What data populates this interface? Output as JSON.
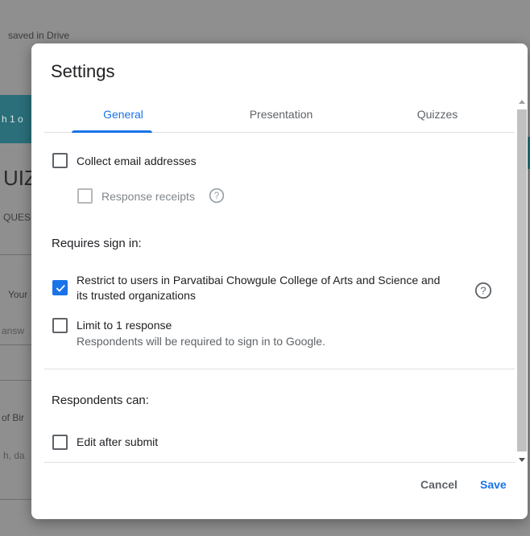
{
  "background": {
    "top_text": "saved in Drive",
    "left_fragments": [
      "h 1 o",
      "UIZ",
      "QUES",
      "Your",
      "answ",
      "of Bir",
      "h, da"
    ]
  },
  "dialog": {
    "title": "Settings",
    "tabs": [
      {
        "label": "General",
        "active": true
      },
      {
        "label": "Presentation",
        "active": false
      },
      {
        "label": "Quizzes",
        "active": false
      }
    ],
    "options": {
      "collect_email": {
        "label": "Collect email addresses",
        "checked": false
      },
      "response_receipts": {
        "label": "Response receipts",
        "checked": false,
        "disabled": true
      },
      "requires_sign_in_heading": "Requires sign in:",
      "restrict_users": {
        "label_line1": "Restrict to users in Parvatibai Chowgule College of Arts and Science and",
        "label_line2": "its trusted organizations",
        "checked": true
      },
      "limit_response": {
        "label": "Limit to 1 response",
        "sublabel": "Respondents will be required to sign in to Google.",
        "checked": false
      },
      "respondents_can_heading": "Respondents can:",
      "edit_after_submit": {
        "label": "Edit after submit",
        "checked": false
      }
    },
    "actions": {
      "cancel": "Cancel",
      "save": "Save"
    }
  },
  "colors": {
    "accent": "#1a73e8",
    "overlay": "#8f8f8f"
  }
}
